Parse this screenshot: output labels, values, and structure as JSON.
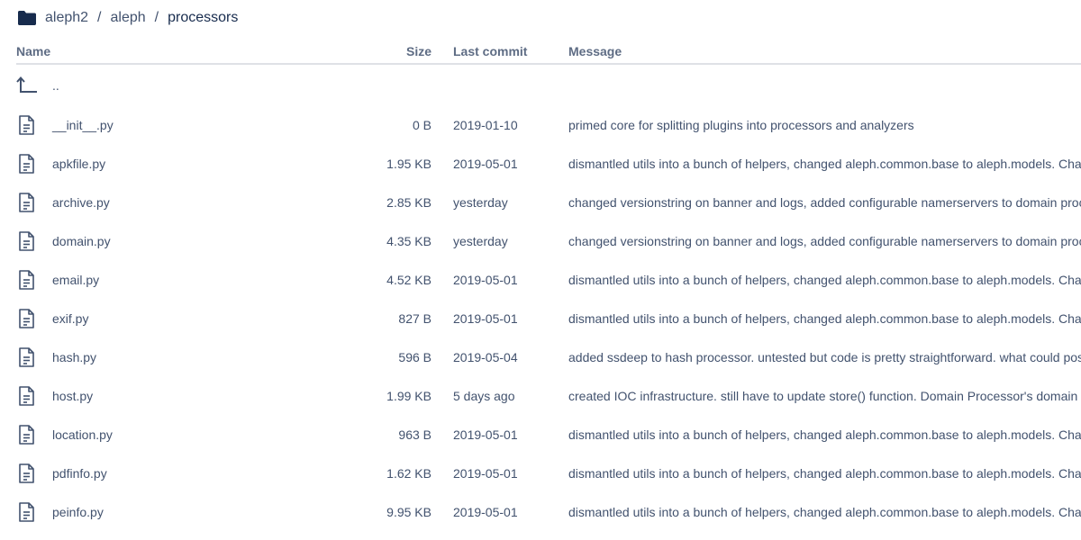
{
  "breadcrumb": {
    "icon": "folder-icon",
    "items": [
      "aleph2",
      "aleph"
    ],
    "separator": "/",
    "current": "processors"
  },
  "table": {
    "headers": {
      "name": "Name",
      "size": "Size",
      "last_commit": "Last commit",
      "message": "Message"
    },
    "parent": {
      "icon": "parent-directory-icon",
      "label": ".."
    },
    "rows": [
      {
        "name": "__init__.py",
        "size": "0 B",
        "date": "2019-01-10",
        "message": "primed core for splitting plugins into processors and analyzers"
      },
      {
        "name": "apkfile.py",
        "size": "1.95 KB",
        "date": "2019-05-01",
        "message": "dismantled utils into a bunch of helpers, changed aleph.common.base to aleph.models. Chan"
      },
      {
        "name": "archive.py",
        "size": "2.85 KB",
        "date": "yesterday",
        "message": "changed versionstring on banner and logs, added configurable namerservers to domain proc"
      },
      {
        "name": "domain.py",
        "size": "4.35 KB",
        "date": "yesterday",
        "message": "changed versionstring on banner and logs, added configurable namerservers to domain proc"
      },
      {
        "name": "email.py",
        "size": "4.52 KB",
        "date": "2019-05-01",
        "message": "dismantled utils into a bunch of helpers, changed aleph.common.base to aleph.models. Chan"
      },
      {
        "name": "exif.py",
        "size": "827 B",
        "date": "2019-05-01",
        "message": "dismantled utils into a bunch of helpers, changed aleph.common.base to aleph.models. Chan"
      },
      {
        "name": "hash.py",
        "size": "596 B",
        "date": "2019-05-04",
        "message": "added ssdeep to hash processor. untested but code is pretty straightforward. what could pos"
      },
      {
        "name": "host.py",
        "size": "1.99 KB",
        "date": "5 days ago",
        "message": "created IOC infrastructure. still have to update store() function. Domain Processor's domain e"
      },
      {
        "name": "location.py",
        "size": "963 B",
        "date": "2019-05-01",
        "message": "dismantled utils into a bunch of helpers, changed aleph.common.base to aleph.models. Chan"
      },
      {
        "name": "pdfinfo.py",
        "size": "1.62 KB",
        "date": "2019-05-01",
        "message": "dismantled utils into a bunch of helpers, changed aleph.common.base to aleph.models. Chan"
      },
      {
        "name": "peinfo.py",
        "size": "9.95 KB",
        "date": "2019-05-01",
        "message": "dismantled utils into a bunch of helpers, changed aleph.common.base to aleph.models. Chan"
      }
    ],
    "file_icon": "file-icon"
  },
  "colors": {
    "text_primary": "#172b4d",
    "text_secondary": "#42526e",
    "header_text": "#5e6c84",
    "border": "#dfe1e6"
  }
}
